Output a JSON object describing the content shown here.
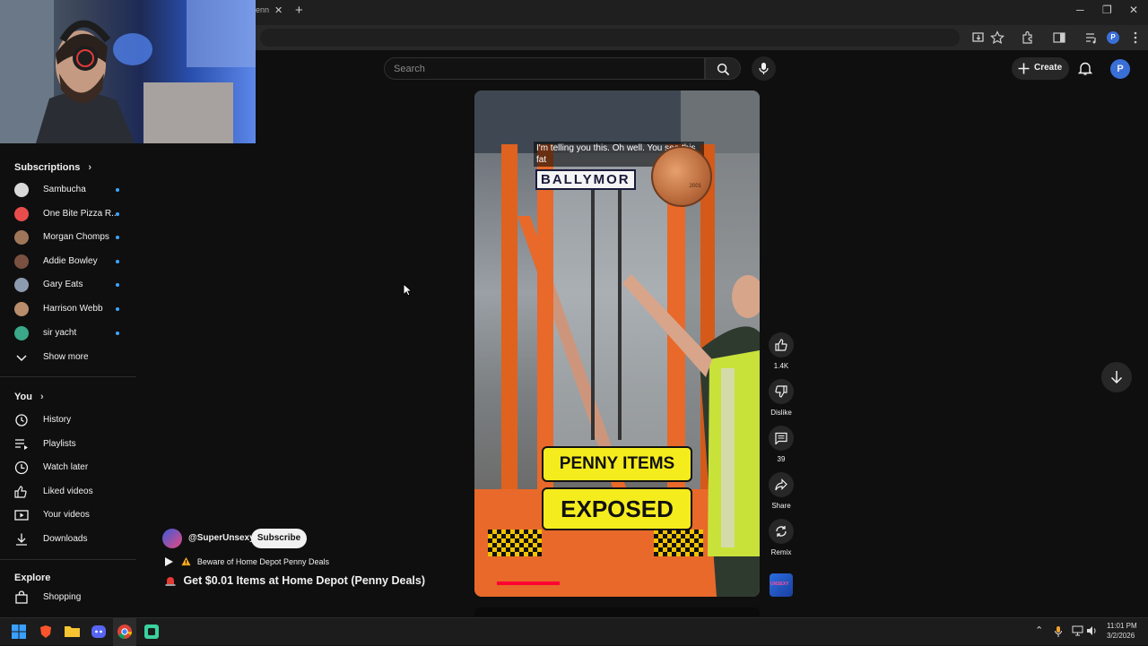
{
  "browser": {
    "tab_fragment": "enn",
    "new_tab_symbol": "+",
    "profile_initial": "P"
  },
  "youtube": {
    "search_placeholder": "Search",
    "create_label": "Create",
    "avatar_initial": "P"
  },
  "sidebar": {
    "subscriptions_title": "Subscriptions",
    "subscriptions": [
      {
        "name": "Sambucha",
        "avatar_color": "#d9d9d9"
      },
      {
        "name": "One Bite Pizza R...",
        "avatar_color": "#e94c4c"
      },
      {
        "name": "Morgan Chomps",
        "avatar_color": "#a0765a"
      },
      {
        "name": "Addie Bowley",
        "avatar_color": "#7a5140"
      },
      {
        "name": "Gary Eats",
        "avatar_color": "#8d9bb0"
      },
      {
        "name": "Harrison Webb",
        "avatar_color": "#b98d6b"
      },
      {
        "name": "sir yacht",
        "avatar_color": "#3aa889"
      }
    ],
    "show_more": "Show more",
    "you_title": "You",
    "you_items": [
      {
        "label": "History",
        "icon": "history-icon"
      },
      {
        "label": "Playlists",
        "icon": "playlists-icon"
      },
      {
        "label": "Watch later",
        "icon": "watch-later-icon"
      },
      {
        "label": "Liked videos",
        "icon": "liked-videos-icon"
      },
      {
        "label": "Your videos",
        "icon": "your-videos-icon"
      },
      {
        "label": "Downloads",
        "icon": "downloads-icon"
      }
    ],
    "explore_title": "Explore",
    "explore_items": [
      {
        "label": "Shopping",
        "icon": "shopping-icon"
      }
    ]
  },
  "short": {
    "caption_text": "I'm telling you this. Oh well. You see this fat",
    "sign_text": "BALLYMOR",
    "overlay_line1": "PENNY ITEMS",
    "overlay_line2": "EXPOSED",
    "coin_year": "2001",
    "channel": "@SuperUnsexy",
    "subscribe_label": "Subscribe",
    "linked_video_title": "Beware of Home Depot Penny Deals",
    "title": "Get $0.01 Items at Home Depot (Penny Deals)",
    "actions": {
      "like_count": "1.4K",
      "dislike_label": "Dislike",
      "comment_count": "39",
      "share_label": "Share",
      "remix_label": "Remix"
    },
    "channel_badge_text": "UNSEXY"
  },
  "taskbar": {
    "time": "11:01 PM",
    "date": "3/2/2026"
  }
}
